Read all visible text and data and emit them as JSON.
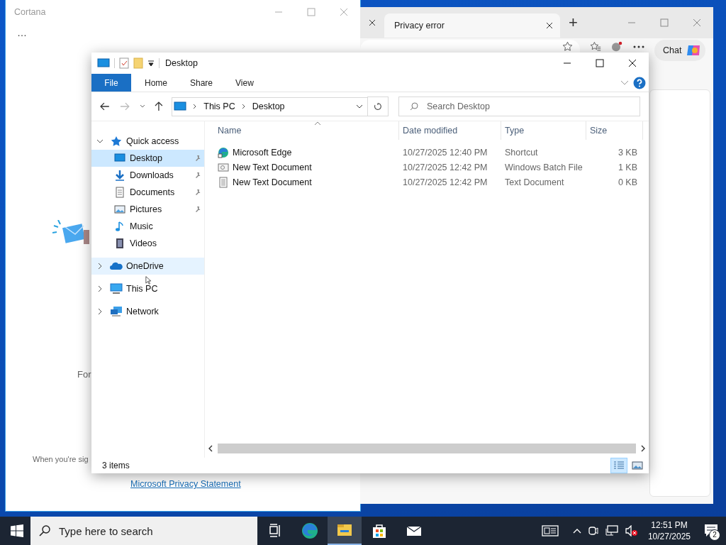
{
  "cortana": {
    "title": "Cortana",
    "menu": "…",
    "texts": [
      "For",
      "When you're sig"
    ],
    "link": "Microsoft Privacy Statement"
  },
  "browser": {
    "tabs": [
      {
        "title": "Privacy error",
        "selected": true
      }
    ],
    "new_tab": "+",
    "chat": "Chat"
  },
  "explorer": {
    "title": "Desktop",
    "ribbon_tabs": [
      {
        "label": "File",
        "selected": true
      },
      {
        "label": "Home",
        "selected": false
      },
      {
        "label": "Share",
        "selected": false
      },
      {
        "label": "View",
        "selected": false
      }
    ],
    "breadcrumb": [
      "This PC",
      "Desktop"
    ],
    "search": {
      "placeholder": "Search Desktop"
    },
    "nav": [
      {
        "label": "Quick access",
        "kind": "star",
        "expanded": true,
        "selected": false,
        "hovered": false,
        "children": [
          {
            "label": "Desktop",
            "kind": "desktop",
            "selected": true,
            "hovered": false,
            "pinned": true
          },
          {
            "label": "Downloads",
            "kind": "downloads",
            "selected": false,
            "hovered": false,
            "pinned": true
          },
          {
            "label": "Documents",
            "kind": "documents",
            "selected": false,
            "hovered": false,
            "pinned": true
          },
          {
            "label": "Pictures",
            "kind": "pictures",
            "selected": false,
            "hovered": false,
            "pinned": true
          },
          {
            "label": "Music",
            "kind": "music",
            "selected": false,
            "hovered": false,
            "pinned": false
          },
          {
            "label": "Videos",
            "kind": "videos",
            "selected": false,
            "hovered": false,
            "pinned": false
          }
        ]
      },
      {
        "label": "OneDrive",
        "kind": "cloud",
        "expanded": false,
        "selected": false,
        "hovered": true
      },
      {
        "label": "This PC",
        "kind": "pc",
        "expanded": false,
        "selected": false,
        "hovered": false
      },
      {
        "label": "Network",
        "kind": "network",
        "expanded": false,
        "selected": false,
        "hovered": false
      }
    ],
    "columns": [
      "Name",
      "Date modified",
      "Type",
      "Size"
    ],
    "files": [
      {
        "name": "Microsoft Edge",
        "date": "10/27/2025 12:40 PM",
        "type": "Shortcut",
        "size": "3 KB",
        "kind": "shortcut"
      },
      {
        "name": "New Text Document",
        "date": "10/27/2025 12:42 PM",
        "type": "Windows Batch File",
        "size": "1 KB",
        "kind": "batch"
      },
      {
        "name": "New Text Document",
        "date": "10/27/2025 12:42 PM",
        "type": "Text Document",
        "size": "0 KB",
        "kind": "text"
      }
    ],
    "status": "3 items"
  },
  "taskbar": {
    "search": {
      "placeholder": "Type here to search"
    },
    "apps": [
      {
        "kind": "task-view",
        "active": false
      },
      {
        "kind": "edge",
        "active": false
      },
      {
        "kind": "explorer",
        "active": true
      },
      {
        "kind": "store",
        "active": false
      },
      {
        "kind": "mail",
        "active": false
      }
    ],
    "time": "12:51 PM",
    "date": "10/27/2025",
    "notifications": "2"
  }
}
